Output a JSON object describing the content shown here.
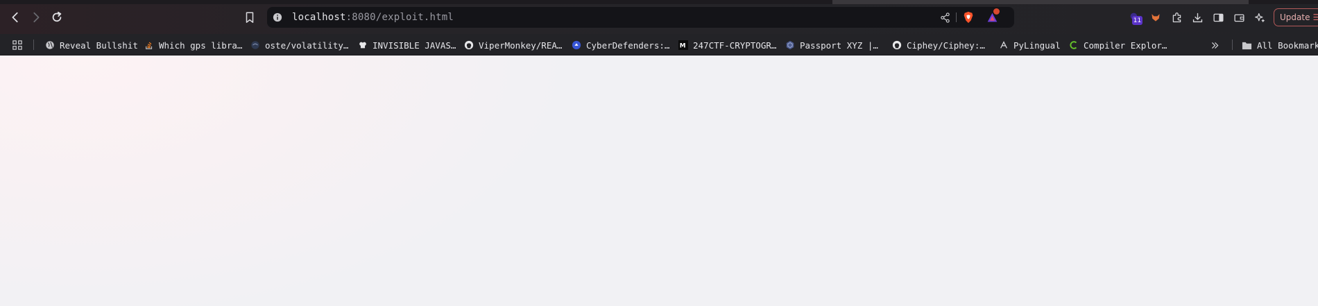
{
  "browser": {
    "url_host": "localhost",
    "url_path": ":8080/exploit.html",
    "extensions_badge": "11",
    "update_label": "Update"
  },
  "bookmarks": [
    {
      "label": "Reveal Bullshit",
      "icon": "globe-icon"
    },
    {
      "label": "Which gps libra…",
      "icon": "stackoverflow-icon"
    },
    {
      "label": "oste/volatility…",
      "icon": "volatility-icon"
    },
    {
      "label": "INVISIBLE JAVAS…",
      "icon": "chef-icon"
    },
    {
      "label": "ViperMonkey/REA…",
      "icon": "github-icon"
    },
    {
      "label": "CyberDefenders:…",
      "icon": "cyberdefenders-icon"
    },
    {
      "label": "247CTF-CRYPTOGR…",
      "icon": "medium-icon"
    },
    {
      "label": "Passport XYZ |…",
      "icon": "passport-icon"
    },
    {
      "label": "Ciphey/Ciphey:…",
      "icon": "github-icon"
    },
    {
      "label": "PyLingual",
      "icon": "pylingual-icon"
    },
    {
      "label": "Compiler Explor…",
      "icon": "compiler-explorer-icon"
    }
  ],
  "all_bookmarks_label": "All Bookmarks"
}
